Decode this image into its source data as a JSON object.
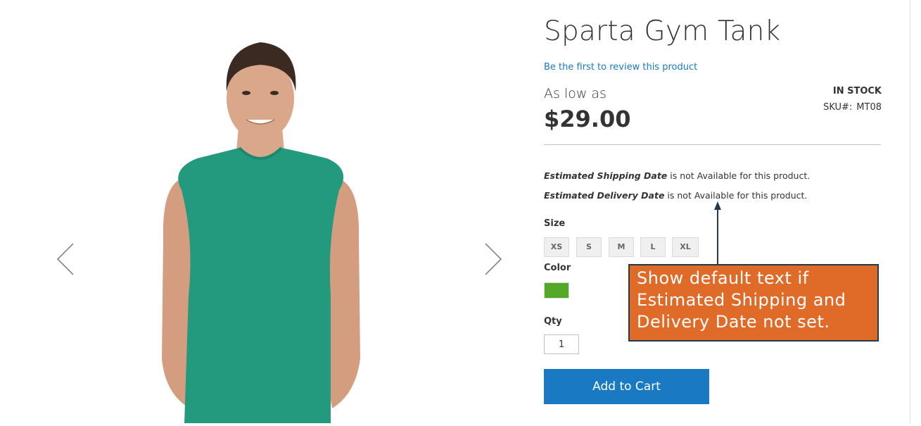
{
  "product": {
    "title": "Sparta Gym Tank",
    "review_link": "Be the first to review this product",
    "as_low_as": "As low as",
    "price": "$29.00",
    "stock": "IN STOCK",
    "sku_label": "SKU#:",
    "sku_value": "MT08"
  },
  "shipping": {
    "line1_bold": "Estimated Shipping Date",
    "line1_rest": " is not Available for this product.",
    "line2_bold": "Estimated Delivery Date",
    "line2_rest": " is not Available for this product."
  },
  "options": {
    "size_label": "Size",
    "sizes": [
      "XS",
      "S",
      "M",
      "L",
      "XL"
    ],
    "color_label": "Color",
    "color_value": "#53a828",
    "qty_label": "Qty",
    "qty_value": "1"
  },
  "actions": {
    "add_to_cart": "Add to Cart"
  },
  "annotation": {
    "text": "Show default text if Estimated Shipping and Delivery Date not set.",
    "line1": "Show default text if",
    "line2": "Estimated Shipping and",
    "line3": "Delivery Date not set.",
    "color": "#e06a28"
  },
  "gallery": {
    "prev_icon": "chevron-left-icon",
    "next_icon": "chevron-right-icon",
    "image_subject": "man-in-green-tank-top"
  },
  "colors": {
    "accent": "#1979c3",
    "text": "#333333"
  }
}
